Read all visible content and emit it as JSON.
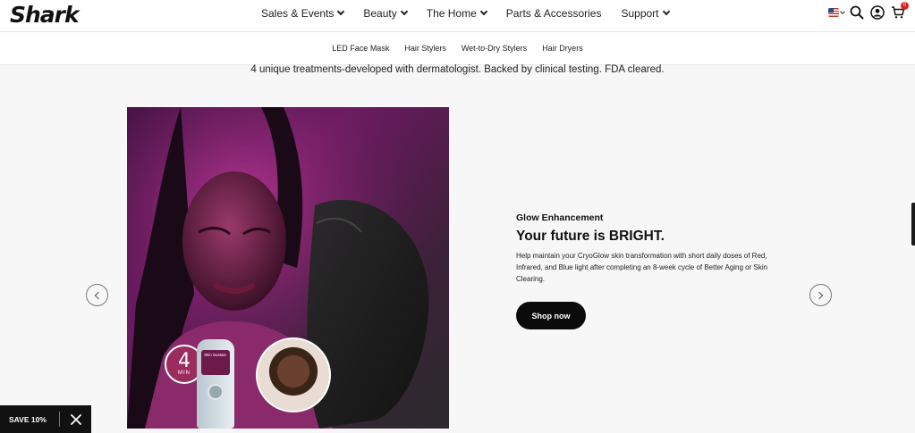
{
  "brand": {
    "logo_text": "Shark"
  },
  "main_nav": [
    {
      "label": "Sales & Events"
    },
    {
      "label": "Beauty"
    },
    {
      "label": "The Home"
    },
    {
      "label": "Parts & Accessories"
    },
    {
      "label": "Support"
    }
  ],
  "utilities": {
    "cart_count": "0",
    "icons": [
      "us-flag-icon",
      "search-icon",
      "account-icon",
      "cart-icon"
    ]
  },
  "sub_nav": [
    {
      "label": "LED Face Mask"
    },
    {
      "label": "Hair Stylers"
    },
    {
      "label": "Wet-to-Dry Stylers"
    },
    {
      "label": "Hair Dryers"
    }
  ],
  "tagline": "4 unique treatments-developed with dermatologist. Backed by clinical testing. FDA cleared.",
  "slide": {
    "badge_number": "4",
    "badge_unit": "MIN",
    "device_screen_text": "Skin Sustain",
    "eyebrow": "Glow Enhancement",
    "headline": "Your future is BRIGHT.",
    "body": "Help maintain your CryoGlow skin transformation with short daily doses of Red, Infrared, and Blue light after completing an 8-week cycle of Better Aging or Skin Clearing.",
    "cta_label": "Shop now"
  },
  "promo": {
    "label": "SAVE 10%"
  },
  "colors": {
    "accent": "#111111",
    "badge": "#9b2c5e",
    "cart_badge": "#d9241c"
  }
}
